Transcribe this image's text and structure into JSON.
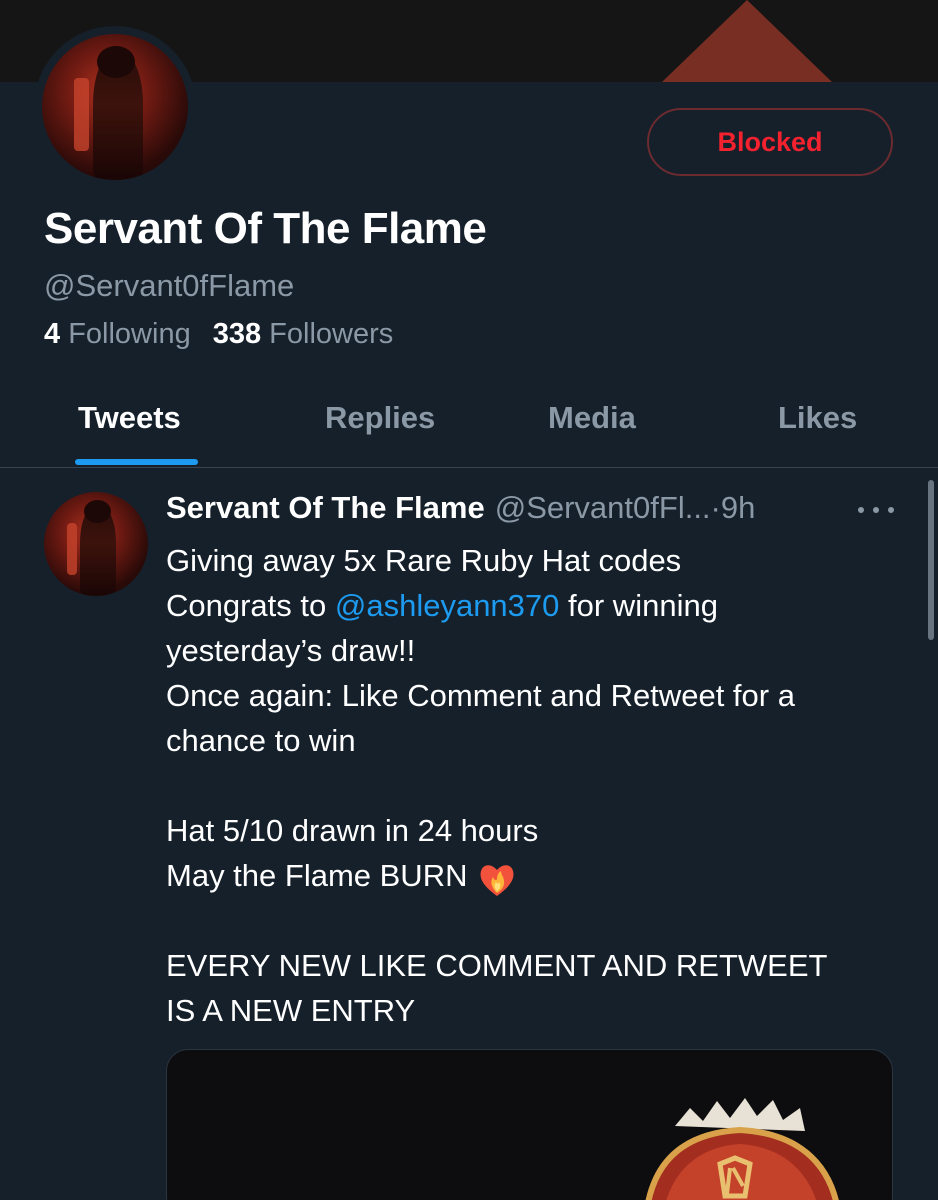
{
  "profile": {
    "display_name": "Servant Of The Flame",
    "handle": "@Servant0fFlame",
    "button_label": "Blocked",
    "following_count": "4",
    "following_label": "Following",
    "followers_count": "338",
    "followers_label": "Followers"
  },
  "tabs": [
    {
      "label": "Tweets",
      "active": true
    },
    {
      "label": "Replies",
      "active": false
    },
    {
      "label": "Media",
      "active": false
    },
    {
      "label": "Likes",
      "active": false
    }
  ],
  "tweet": {
    "author_name": "Servant Of The Flame",
    "author_handle": "@Servant0fFl...",
    "separator": " · ",
    "time": "9h",
    "line1": "Giving away 5x Rare Ruby Hat codes",
    "line2_pre": "Congrats to ",
    "line2_mention": "@ashleyann370",
    "line2_post": " for winning",
    "line3": "yesterday’s draw!!",
    "line4": "Once again: Like Comment and Retweet for a",
    "line5": "chance to win",
    "line6": "Hat 5/10 drawn in 24 hours",
    "line7": "May the Flame BURN",
    "emoji": "heart-on-fire",
    "line8": "EVERY NEW LIKE COMMENT AND RETWEET",
    "line9": "IS A NEW ENTRY"
  },
  "colors": {
    "background": "#15202b",
    "accent": "#1d9bf0",
    "blocked_red": "#f4212e",
    "muted_text": "#8b98a5"
  },
  "icons": [
    "more-icon",
    "heart-on-fire-emoji"
  ]
}
